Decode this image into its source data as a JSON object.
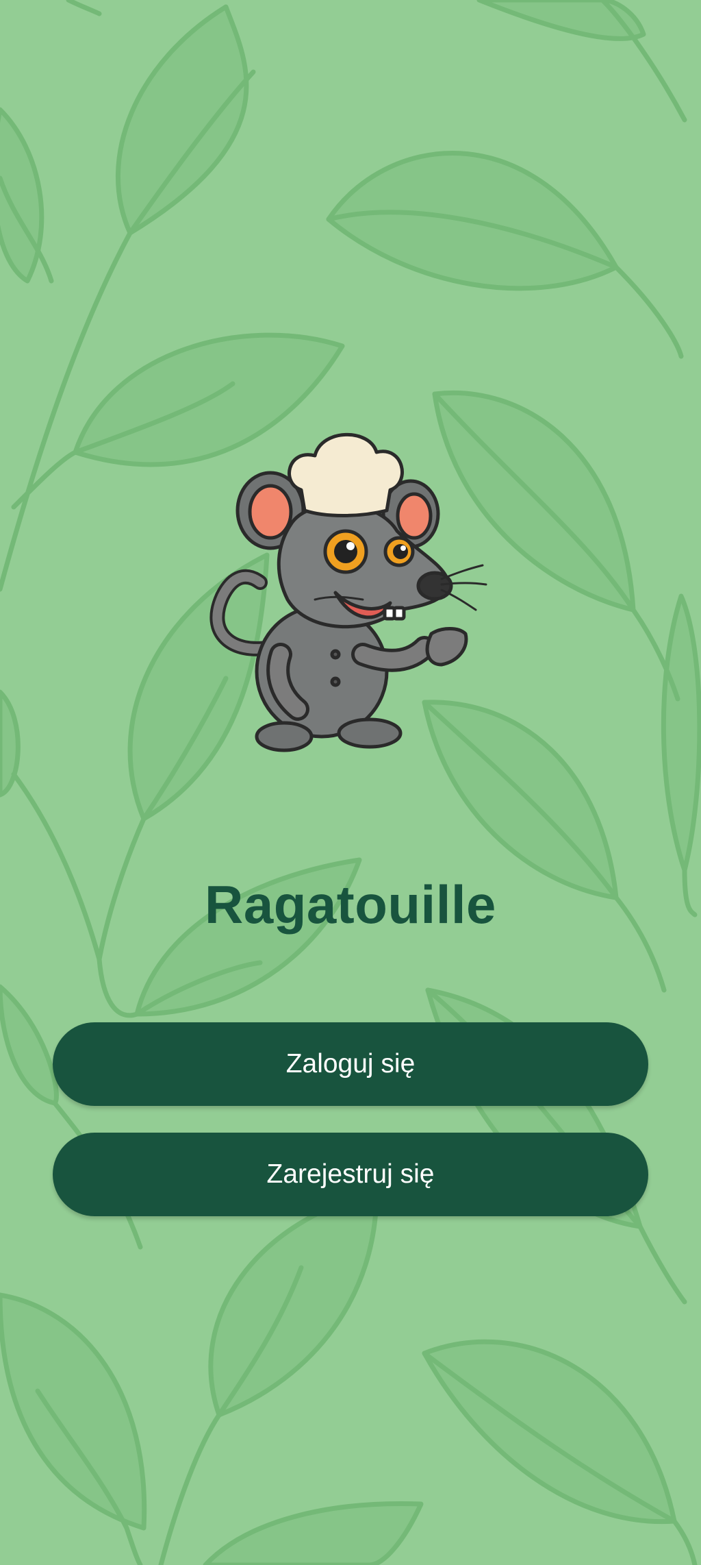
{
  "colors": {
    "background": "#93cd94",
    "leaf_fill": "#86c588",
    "leaf_stroke": "#74b977",
    "primary": "#18543e",
    "button_text": "#ffffff"
  },
  "mascot": {
    "icon": "chef-rat-mascot"
  },
  "app": {
    "title": "Ragatouille"
  },
  "actions": {
    "login_label": "Zaloguj się",
    "register_label": "Zarejestruj się"
  }
}
